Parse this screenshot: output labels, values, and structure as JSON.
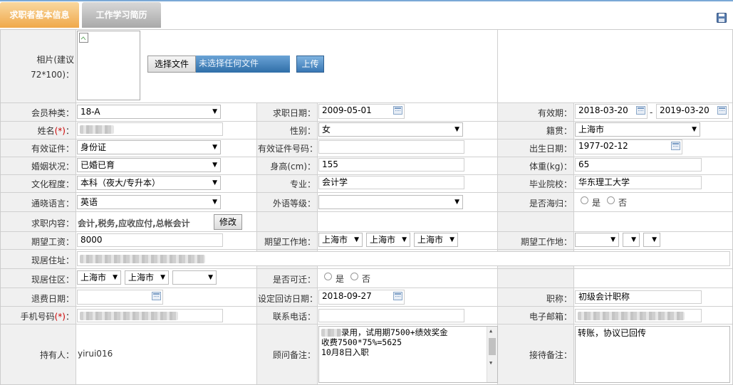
{
  "tabs": [
    {
      "label": "求职者基本信息"
    },
    {
      "label": "工作学习简历"
    }
  ],
  "photo": {
    "label_line1": "相片(建议",
    "label_line2": "72*100)：",
    "choose_label": "选择文件",
    "no_file_label": "未选择任何文件",
    "upload_label": "上传"
  },
  "member": {
    "label": "会员种类：",
    "value": "18-A"
  },
  "apply_date": {
    "label": "求职日期：",
    "value": "2009-05-01"
  },
  "valid": {
    "label": "有效期：",
    "from": "2018-03-20",
    "sep": "-",
    "to": "2019-03-20"
  },
  "name": {
    "label": "姓名",
    "req": "(*)",
    "colon": "："
  },
  "gender": {
    "label": "性别：",
    "value": "女"
  },
  "native": {
    "label": "籍贯：",
    "value": "上海市"
  },
  "id_type": {
    "label": "有效证件：",
    "value": "身份证"
  },
  "id_no": {
    "label": "有效证件号码："
  },
  "birth": {
    "label": "出生日期：",
    "value": "1977-02-12"
  },
  "marital": {
    "label": "婚姻状况：",
    "value": "已婚已育"
  },
  "height": {
    "label": "身高(cm)：",
    "value": "155"
  },
  "weight": {
    "label": "体重(kg)：",
    "value": "65"
  },
  "edu": {
    "label": "文化程度：",
    "value": "本科（夜大/专升本）"
  },
  "major": {
    "label": "专业：",
    "value": "会计学"
  },
  "school": {
    "label": "毕业院校：",
    "value": "华东理工大学"
  },
  "language": {
    "label": "通晓语言：",
    "value": "英语"
  },
  "foreign_level": {
    "label": "外语等级："
  },
  "returnee": {
    "label": "是否海归：",
    "yes": "是",
    "no": "否"
  },
  "job_content": {
    "label": "求职内容：",
    "value": "会计,税务,应收应付,总帐会计",
    "edit_label": "修改"
  },
  "salary": {
    "label": "期望工资：",
    "value": "8000"
  },
  "work_place1": {
    "label": "期望工作地：",
    "p1": "上海市",
    "p2": "上海市",
    "p3": "上海市"
  },
  "work_place2": {
    "label": "期望工作地："
  },
  "address": {
    "label": "现居住址："
  },
  "district": {
    "label": "现居住区：",
    "p1": "上海市",
    "p2": "上海市"
  },
  "relocate": {
    "label": "是否可迁：",
    "yes": "是",
    "no": "否"
  },
  "refund": {
    "label": "退费日期："
  },
  "visit": {
    "label": "设定回访日期：",
    "value": "2018-09-27"
  },
  "title": {
    "label": "职称：",
    "value": "初级会计职称"
  },
  "mobile": {
    "label": "手机号码",
    "req": "(*)",
    "colon": "："
  },
  "phone": {
    "label": "联系电话："
  },
  "email": {
    "label": "电子邮箱："
  },
  "owner": {
    "label": "持有人：",
    "value": "yirui016"
  },
  "advisor_note": {
    "label": "顾问备注：",
    "line1": "录用，试用期7500+绩效奖金",
    "line2": "收费7500*75%=5625",
    "line3": "10月8日入职"
  },
  "reception_note": {
    "label": "接待备注：",
    "value": "转账，协议已回传"
  }
}
